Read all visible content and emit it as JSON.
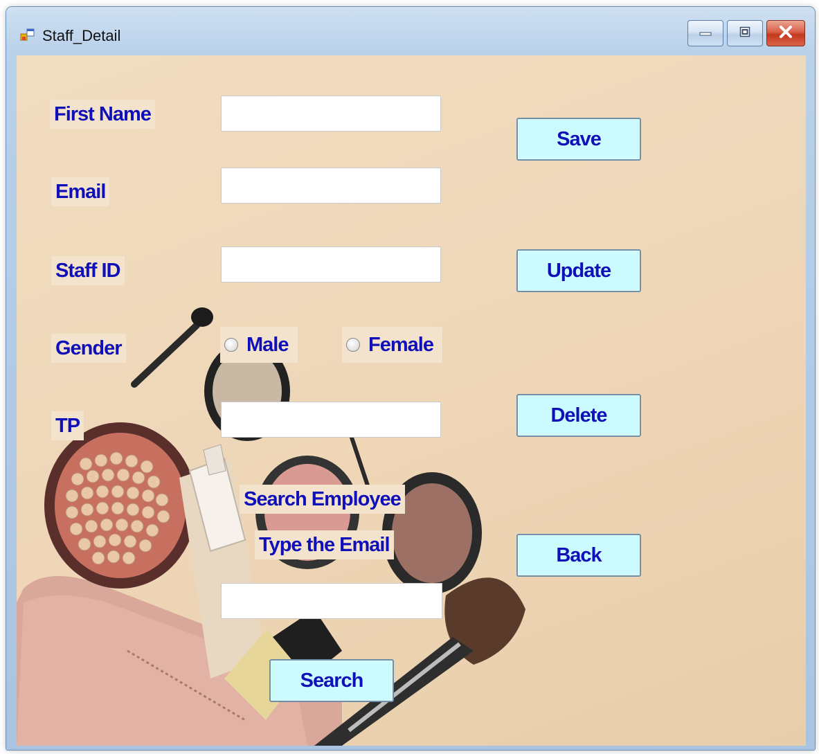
{
  "window": {
    "title": "Staff_Detail"
  },
  "form": {
    "first_name_label": "First Name",
    "first_name_value": "",
    "email_label": "Email",
    "email_value": "",
    "staff_id_label": "Staff ID",
    "staff_id_value": "",
    "gender_label": "Gender",
    "gender_options": [
      "Male",
      "Female"
    ],
    "tp_label": "TP",
    "tp_value": "",
    "search_heading": "Search Employee",
    "search_hint": "Type the Email",
    "search_value": ""
  },
  "buttons": {
    "save": "Save",
    "update": "Update",
    "delete": "Delete",
    "back": "Back",
    "search": "Search"
  },
  "colors": {
    "label_text": "#1010b8",
    "button_face": "#ccfbff",
    "background": "#efd8ba"
  },
  "icons": {
    "app": "winforms-app-icon",
    "minimize": "minimize-icon",
    "maximize": "maximize-icon",
    "close": "close-icon"
  }
}
